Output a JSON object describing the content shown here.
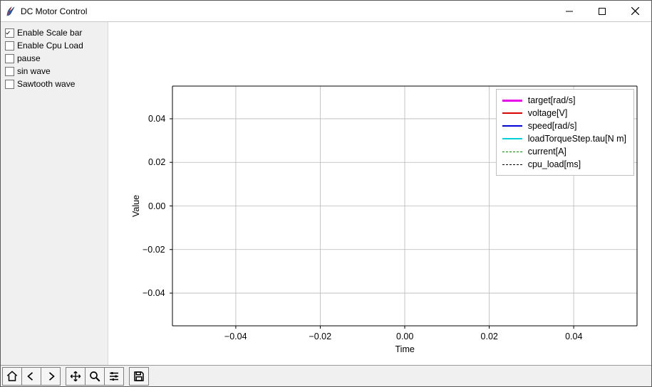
{
  "window": {
    "title": "DC Motor Control"
  },
  "sidebar": {
    "items": [
      {
        "label": "Enable Scale bar",
        "checked": true
      },
      {
        "label": "Enable Cpu Load",
        "checked": false
      },
      {
        "label": "pause",
        "checked": false
      },
      {
        "label": "sin wave",
        "checked": false
      },
      {
        "label": "Sawtooth wave",
        "checked": false
      }
    ]
  },
  "toolbar": {
    "buttons": [
      "home",
      "back",
      "forward",
      "pan",
      "zoom",
      "configure",
      "save"
    ]
  },
  "chart_data": {
    "type": "line",
    "title": "",
    "xlabel": "Time",
    "ylabel": "Value",
    "xlim": [
      -0.055,
      0.055
    ],
    "ylim": [
      -0.055,
      0.055
    ],
    "xticks": [
      -0.04,
      -0.02,
      0.0,
      0.02,
      0.04
    ],
    "yticks": [
      -0.04,
      -0.02,
      0.0,
      0.02,
      0.04
    ],
    "xtick_labels": [
      "−0.04",
      "−0.02",
      "0.00",
      "0.02",
      "0.04"
    ],
    "ytick_labels": [
      "−0.04",
      "−0.02",
      "0.00",
      "0.02",
      "0.04"
    ],
    "grid": true,
    "legend_position": "upper right",
    "series": [
      {
        "name": "target[rad/s]",
        "color": "#e800e8",
        "style": "solid",
        "width": 3,
        "x": [],
        "y": []
      },
      {
        "name": "voltage[V]",
        "color": "#d80000",
        "style": "solid",
        "width": 1.5,
        "x": [],
        "y": []
      },
      {
        "name": "speed[rad/s]",
        "color": "#0000d8",
        "style": "solid",
        "width": 1.5,
        "x": [],
        "y": []
      },
      {
        "name": "loadTorqueStep.tau[N m]",
        "color": "#00d0d8",
        "style": "solid",
        "width": 1.5,
        "x": [],
        "y": []
      },
      {
        "name": "current[A]",
        "color": "#008800",
        "style": "dashed",
        "width": 1.2,
        "x": [],
        "y": []
      },
      {
        "name": "cpu_load[ms]",
        "color": "#000000",
        "style": "dashed",
        "width": 1.2,
        "x": [],
        "y": []
      }
    ]
  }
}
